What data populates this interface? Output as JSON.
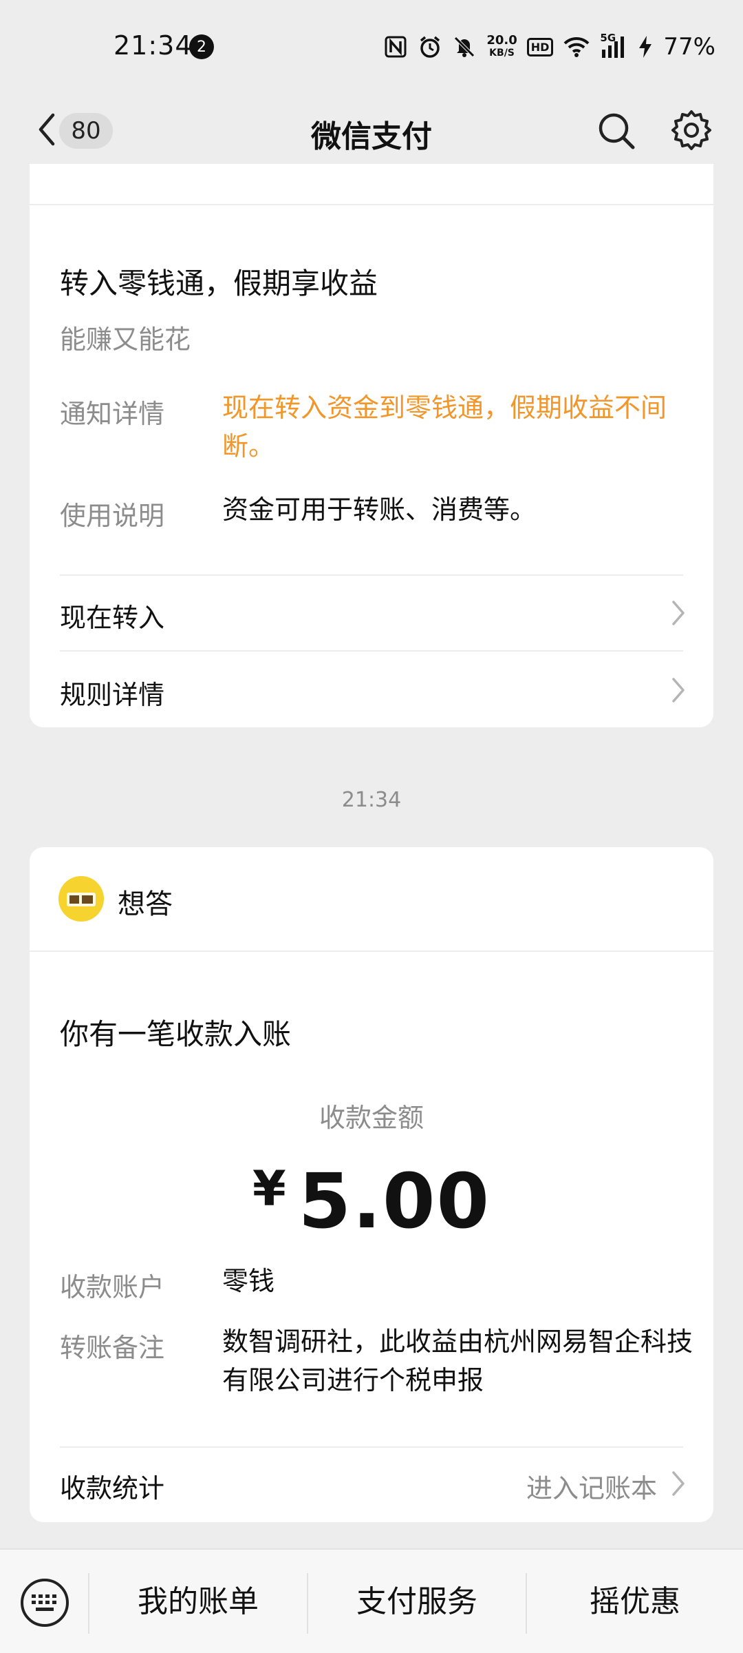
{
  "status_bar": {
    "time": "21:34",
    "notification_count": "2",
    "net_speed_value": "20.0",
    "net_speed_unit": "KB/S",
    "hd_label": "HD",
    "network_label": "5G",
    "battery": "77%"
  },
  "header": {
    "unread_count": "80",
    "title": "微信支付"
  },
  "card1": {
    "title": "转入零钱通，假期享收益",
    "subtitle": "能赚又能花",
    "notice_label": "通知详情",
    "notice_value": "现在转入资金到零钱通，假期收益不间断。",
    "usage_label": "使用说明",
    "usage_value": "资金可用于转账、消费等。",
    "action1": "现在转入",
    "action2": "规则详情",
    "accent_color": "#f0962a"
  },
  "timestamp": "21:34",
  "card2": {
    "sender_name": "想答",
    "title": "你有一笔收款入账",
    "amount_label": "收款金额",
    "currency": "¥",
    "amount": "5.00",
    "account_label": "收款账户",
    "account_value": "零钱",
    "remark_label": "转账备注",
    "remark_value": "数智调研社，此收益由杭州网易智企科技有限公司进行个税申报",
    "stats_label": "收款统计",
    "stats_link": "进入记账本"
  },
  "bottom_menu": {
    "items": [
      "我的账单",
      "支付服务",
      "摇优惠"
    ]
  }
}
